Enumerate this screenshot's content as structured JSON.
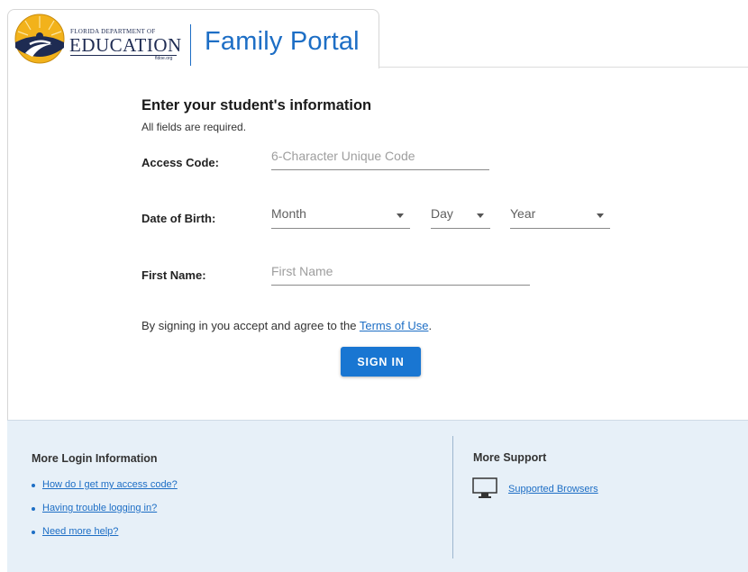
{
  "header": {
    "logo_top_text": "FLORIDA DEPARTMENT OF",
    "logo_main_text": "EDUCATION",
    "logo_url_text": "fldoe.org",
    "portal_title": "Family Portal",
    "accent_color": "#1d6ec5"
  },
  "form": {
    "heading": "Enter your student's information",
    "subtitle": "All fields are required.",
    "access_code": {
      "label": "Access Code:",
      "placeholder": "6-Character Unique Code"
    },
    "dob": {
      "label": "Date of Birth:",
      "month": "Month",
      "day": "Day",
      "year": "Year"
    },
    "first_name": {
      "label": "First Name:",
      "placeholder": "First Name"
    },
    "terms_prefix": "By signing in you accept and agree to the ",
    "terms_link": "Terms of Use",
    "terms_suffix": ".",
    "sign_in_label": "SIGN IN",
    "button_color": "#1976d2"
  },
  "footer": {
    "left_heading": "More Login Information",
    "links": [
      "How do I get my access code?",
      "Having trouble logging in?",
      "Need more help?"
    ],
    "right_heading": "More Support",
    "supported_browsers": "Supported Browsers",
    "monitor_icon": "monitor-icon",
    "background_color": "#e7f0f8"
  }
}
